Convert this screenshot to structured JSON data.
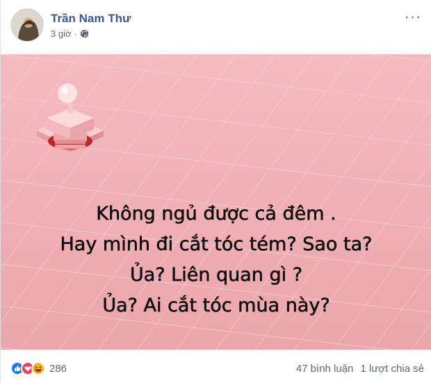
{
  "post": {
    "author": "Trần Nam Thư",
    "time": "3 giờ",
    "separator": "·",
    "privacy_icon": "globe-icon",
    "more_icon": "more-options-icon"
  },
  "image": {
    "lines": [
      "Không ngủ được cả đêm .",
      "Hay mình đi cắt tóc tém? Sao ta?",
      "Ủa? Liên quan gì ?",
      "Ủa? Ai cắt tóc mùa này?"
    ],
    "background_color": "#f0b0b5"
  },
  "footer": {
    "reaction_icons": [
      "like-icon",
      "love-icon",
      "haha-icon"
    ],
    "reaction_count": "286",
    "comments": "47 bình luận",
    "shares": "1 lượt chia sẻ"
  },
  "colors": {
    "author": "#385898",
    "like": "#1877f2",
    "love": "#f33e58",
    "haha": "#f7b125"
  }
}
